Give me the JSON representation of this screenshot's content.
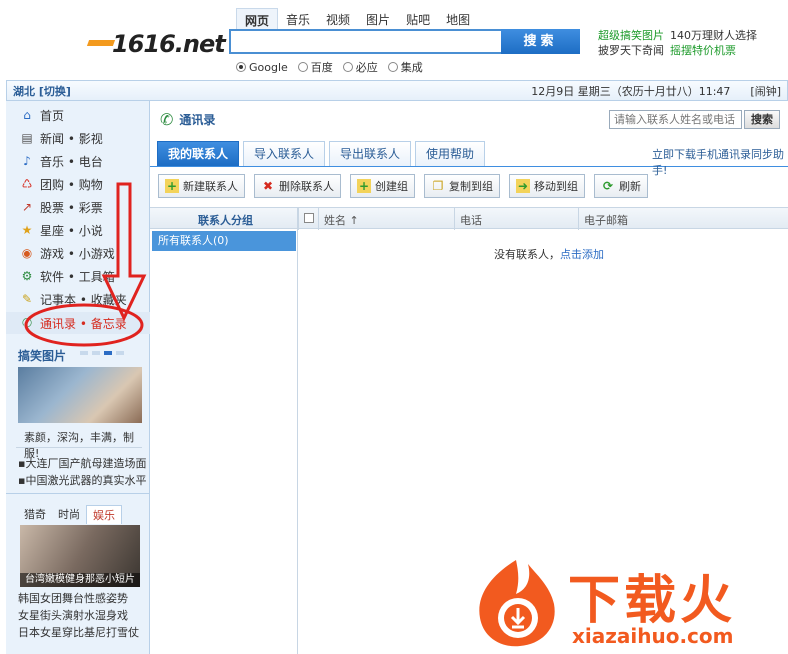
{
  "header": {
    "logo_text": "1616.net",
    "nav_tabs": [
      "网页",
      "音乐",
      "视频",
      "图片",
      "贴吧",
      "地图"
    ],
    "search_button": "搜索",
    "engines": [
      "Google",
      "百度",
      "必应",
      "集成"
    ],
    "promo": [
      {
        "text": "超级搞笑图片",
        "color": "green"
      },
      {
        "text": "140万理财人选择",
        "color": "dark"
      },
      {
        "text": "披罗天下奇闻",
        "color": "dark"
      },
      {
        "text": "摇摆特价机票",
        "color": "green"
      }
    ]
  },
  "topbar": {
    "region": "湖北 [切换]",
    "date": "12月9日  星期三（农历十月廿八）11:47",
    "alarm": "[闹钟]"
  },
  "sidebar": {
    "items": [
      {
        "label": "首页",
        "icon": "home-icon",
        "glyph": "⌂"
      },
      {
        "label": "新闻 • 影视",
        "icon": "news-icon",
        "glyph": "▤"
      },
      {
        "label": "音乐 • 电台",
        "icon": "music-icon",
        "glyph": "♪"
      },
      {
        "label": "团购 • 购物",
        "icon": "cart-icon",
        "glyph": "♺"
      },
      {
        "label": "股票 • 彩票",
        "icon": "stock-icon",
        "glyph": "↗"
      },
      {
        "label": "星座 • 小说",
        "icon": "star-icon",
        "glyph": "★"
      },
      {
        "label": "游戏 • 小游戏",
        "icon": "game-icon",
        "glyph": "◉"
      },
      {
        "label": "软件 • 工具箱",
        "icon": "software-icon",
        "glyph": "⚙"
      },
      {
        "label": "记事本 • 收藏夹",
        "icon": "notepad-icon",
        "glyph": "✎"
      },
      {
        "label": "通讯录 • 备忘录",
        "icon": "contacts-icon",
        "glyph": "✆"
      }
    ],
    "fun_title": "搞笑图片",
    "fun_caption": "素颜，深沟，丰满，制服!",
    "news_links": [
      "大连厂国产航母建造场面",
      "中国激光武器的真实水平"
    ],
    "mini_tabs": [
      "猎奇",
      "时尚",
      "娱乐"
    ],
    "ent_caption": "台湾嫩模健身那恶小短片",
    "ent_links": [
      "韩国女团舞台性感姿势",
      "女星街头演射水湿身戏",
      "日本女星穿比基尼打雪仗"
    ]
  },
  "main": {
    "title": "通讯录",
    "search_placeholder": "请输入联系人姓名或电话",
    "search_button": "搜索",
    "tabs": [
      "我的联系人",
      "导入联系人",
      "导出联系人",
      "使用帮助"
    ],
    "download_link": "立即下载手机通讯录同步助手!",
    "toolbar": [
      {
        "label": "新建联系人",
        "icon": "add-contact-icon",
        "glyph": "+",
        "color": "#2e9a2e"
      },
      {
        "label": "删除联系人",
        "icon": "delete-icon",
        "glyph": "✖",
        "color": "#d62b1f"
      },
      {
        "label": "创建组",
        "icon": "create-group-icon",
        "glyph": "+",
        "color": "#2e9a2e"
      },
      {
        "label": "复制到组",
        "icon": "copy-icon",
        "glyph": "❐",
        "color": "#c9a21a"
      },
      {
        "label": "移动到组",
        "icon": "move-icon",
        "glyph": "➜",
        "color": "#2e9a2e"
      },
      {
        "label": "刷新",
        "icon": "refresh-icon",
        "glyph": "⟳",
        "color": "#2e9a2e"
      }
    ],
    "group_header": "联系人分组",
    "columns": [
      "姓名 ↑",
      "电话",
      "电子邮箱"
    ],
    "all_group": "所有联系人(0)",
    "empty_text": "没有联系人，",
    "empty_link": "点击添加"
  },
  "watermark": {
    "brand": "下载火",
    "domain": "xiazaihuo.com"
  }
}
